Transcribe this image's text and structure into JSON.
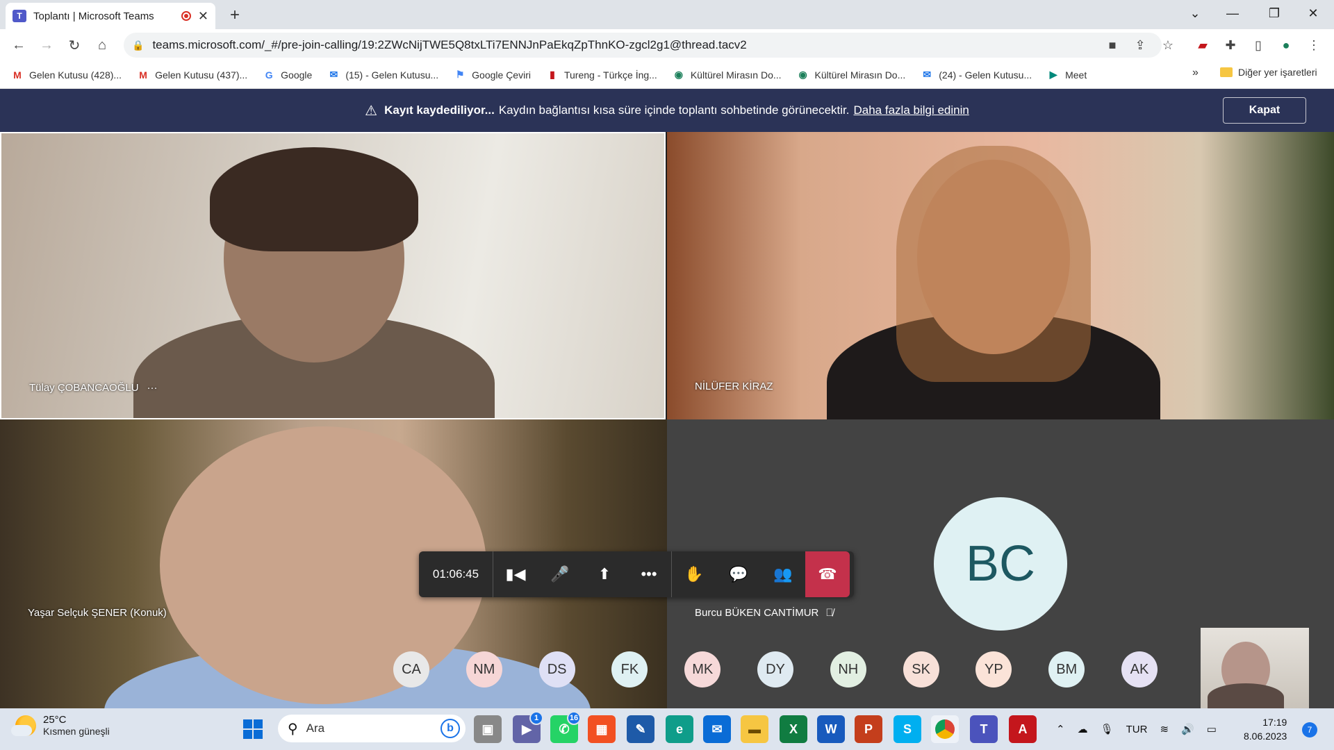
{
  "browser": {
    "tab_title": "Toplantı | Microsoft Teams",
    "url": "teams.microsoft.com/_#/pre-join-calling/19:2ZWcNijTWE5Q8txLTi7ENNJnPaEkqZpThnKO-zgcl2g1@thread.tacv2",
    "bookmarks": [
      {
        "label": "Gelen Kutusu (428)...",
        "icon": "gmail-icon",
        "color": "#d93025"
      },
      {
        "label": "Gelen Kutusu (437)...",
        "icon": "gmail-icon",
        "color": "#d93025"
      },
      {
        "label": "Google",
        "icon": "google-icon",
        "color": "#4285f4"
      },
      {
        "label": "(15) - Gelen Kutusu...",
        "icon": "mail-icon",
        "color": "#1a73e8"
      },
      {
        "label": "Google Çeviri",
        "icon": "translate-icon",
        "color": "#4285f4"
      },
      {
        "label": "Tureng - Türkçe İng...",
        "icon": "tureng-icon",
        "color": "#c4161c"
      },
      {
        "label": "Kültürel Mirasın Do...",
        "icon": "globe-icon",
        "color": "#1b7f5a"
      },
      {
        "label": "Kültürel Mirasın Do...",
        "icon": "globe-icon",
        "color": "#1b7f5a"
      },
      {
        "label": "(24) - Gelen Kutusu...",
        "icon": "mail-icon",
        "color": "#1a73e8"
      },
      {
        "label": "Meet",
        "icon": "meet-icon",
        "color": "#00897b"
      }
    ],
    "more_label": "»",
    "other_bookmarks": "Diğer yer işaretleri"
  },
  "banner": {
    "bold": "Kayıt kaydediliyor...",
    "text": "Kaydın bağlantısı kısa süre içinde toplantı sohbetinde görünecektir.",
    "link": "Daha fazla bilgi edinin",
    "close": "Kapat"
  },
  "participants": {
    "tile1": "Tülay ÇOBANCAOĞLU",
    "tile1_more": "···",
    "tile2": "NİLÜFER KİRAZ",
    "tile3": "Yaşar Selçuk ŞENER (Konuk)",
    "tile4": "Burcu BÜKEN CANTİMUR",
    "tile4_initials": "BC"
  },
  "controls": {
    "timer": "01:06:45"
  },
  "bubbles": [
    {
      "initials": "CA",
      "color": "#e8e8e8"
    },
    {
      "initials": "NM",
      "color": "#f6d6d6"
    },
    {
      "initials": "DS",
      "color": "#dfe0f5"
    },
    {
      "initials": "FK",
      "color": "#dff1f3"
    },
    {
      "initials": "MK",
      "color": "#f6d9d9"
    },
    {
      "initials": "DY",
      "color": "#dfeaf1"
    },
    {
      "initials": "NH",
      "color": "#e2efe2"
    },
    {
      "initials": "SK",
      "color": "#f8e0d8"
    },
    {
      "initials": "YP",
      "color": "#fbe3d8"
    },
    {
      "initials": "BM",
      "color": "#dff1f3"
    },
    {
      "initials": "AK",
      "color": "#e5e1f3"
    }
  ],
  "taskbar": {
    "temp": "25°C",
    "weather": "Kısmen güneşli",
    "search": "Ara",
    "language": "TUR",
    "time": "17:19",
    "date": "8.06.2023",
    "notifications": "7",
    "teams_badge": "1",
    "whatsapp_badge": "16"
  }
}
